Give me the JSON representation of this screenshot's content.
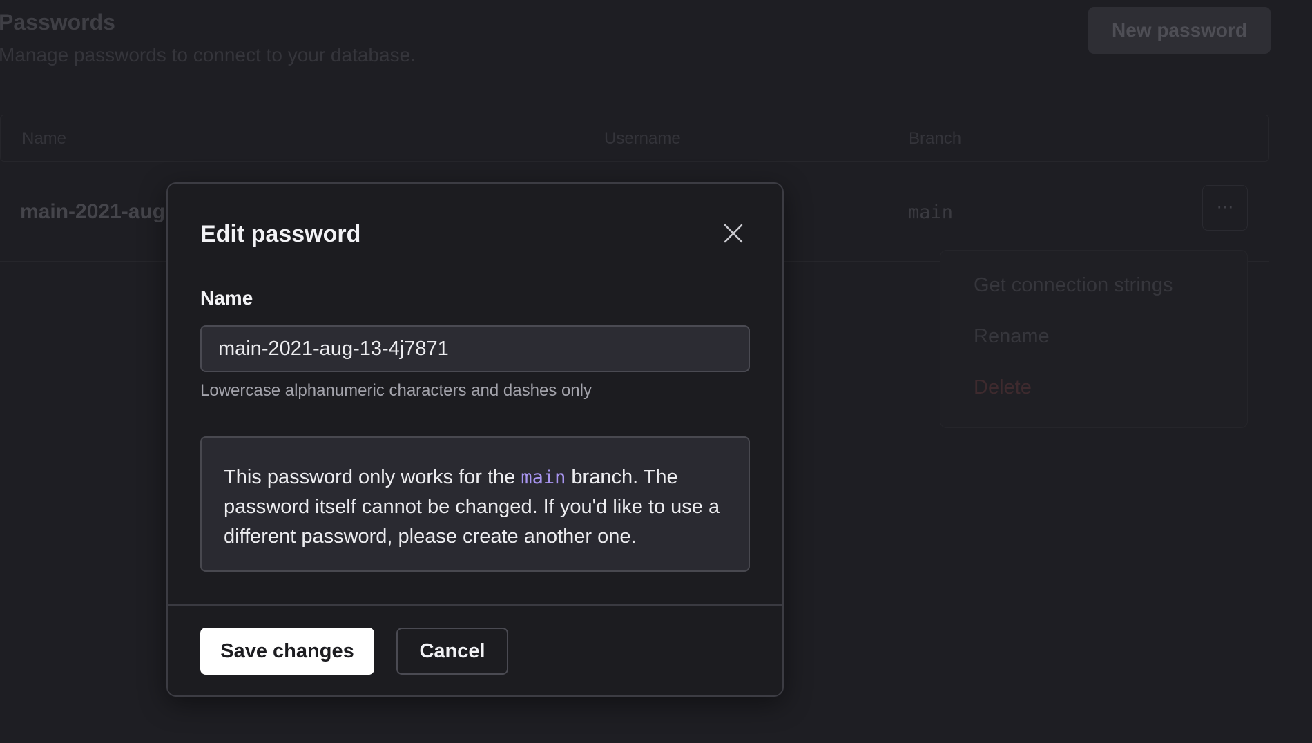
{
  "background": {
    "title": "Passwords",
    "subtitle": "Manage passwords to connect to your database.",
    "new_button": "New password",
    "table": {
      "headers": [
        "Name",
        "Username",
        "Branch"
      ],
      "rows": [
        {
          "name": "main-2021-aug",
          "branch": "main"
        }
      ]
    },
    "more_button": "···",
    "menu": [
      "Get connection strings",
      "Rename",
      "Delete"
    ]
  },
  "modal": {
    "title": "Edit password",
    "field_label": "Name",
    "name_value": "main-2021-aug-13-4j7871",
    "hint": "Lowercase alphanumeric characters and dashes only",
    "info": {
      "before": "This password only works for the ",
      "branch": "main",
      "after": " branch. The password itself cannot be changed. If you'd like to use a different password, please create another one."
    },
    "save_label": "Save changes",
    "cancel_label": "Cancel"
  },
  "colors": {
    "background": "#1e1e23",
    "modal": "#1c1c20",
    "accent_code": "#a895f0",
    "primary_button": "#ffffff",
    "danger": "#3e2a2e"
  },
  "icons": {
    "close": "close-icon",
    "more": "more-horizontal-icon"
  }
}
